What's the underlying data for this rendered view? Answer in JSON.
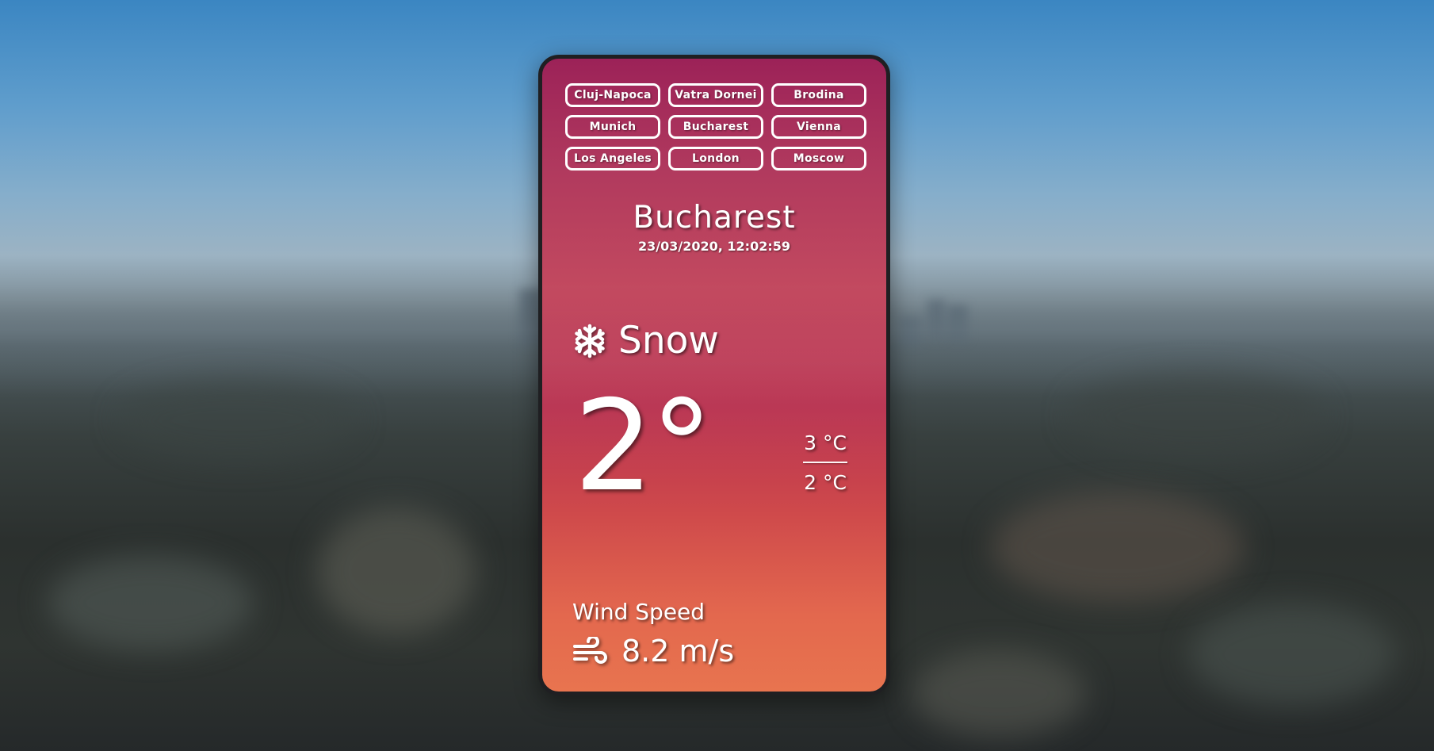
{
  "cities": [
    {
      "label": "Cluj-Napoca"
    },
    {
      "label": "Vatra Dornei"
    },
    {
      "label": "Brodina"
    },
    {
      "label": "Munich"
    },
    {
      "label": "Bucharest"
    },
    {
      "label": "Vienna"
    },
    {
      "label": "Los Angeles"
    },
    {
      "label": "London"
    },
    {
      "label": "Moscow"
    }
  ],
  "location": {
    "city": "Bucharest",
    "datetime": "23/03/2020, 12:02:59"
  },
  "weather": {
    "condition": "Snow",
    "condition_icon": "snowflake-icon",
    "temperature": "2°",
    "max_temp": "3 °C",
    "min_temp": "2 °C",
    "wind_label": "Wind Speed",
    "wind_value": "8.2 m/s",
    "wind_icon": "wind-icon"
  },
  "colors": {
    "card_top": "#9c2258",
    "card_bottom": "#e8744f",
    "card_border": "#1f1f22",
    "text": "#ffffff"
  }
}
